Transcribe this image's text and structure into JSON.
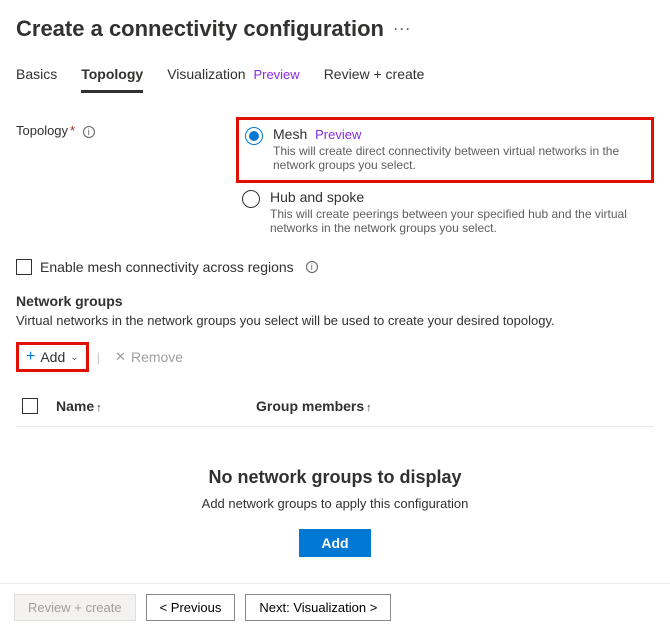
{
  "header": {
    "title": "Create a connectivity configuration"
  },
  "tabs": {
    "basics": "Basics",
    "topology": "Topology",
    "visualization": "Visualization",
    "visualization_badge": "Preview",
    "review": "Review + create"
  },
  "topology_field": {
    "label": "Topology",
    "options": {
      "mesh": {
        "title": "Mesh",
        "badge": "Preview",
        "desc": "This will create direct connectivity between virtual networks in the network groups you select."
      },
      "hubspoke": {
        "title": "Hub and spoke",
        "desc": "This will create peerings between your specified hub and the virtual networks in the network groups you select."
      }
    }
  },
  "mesh_checkbox": "Enable mesh connectivity across regions",
  "network_groups": {
    "heading": "Network groups",
    "desc": "Virtual networks in the network groups you select will be used to create your desired topology.",
    "add_label": "Add",
    "remove_label": "Remove",
    "col_name": "Name",
    "col_members": "Group members",
    "empty_title": "No network groups to display",
    "empty_desc": "Add network groups to apply this configuration",
    "empty_button": "Add"
  },
  "footer": {
    "review": "Review + create",
    "previous": "< Previous",
    "next": "Next: Visualization >"
  }
}
